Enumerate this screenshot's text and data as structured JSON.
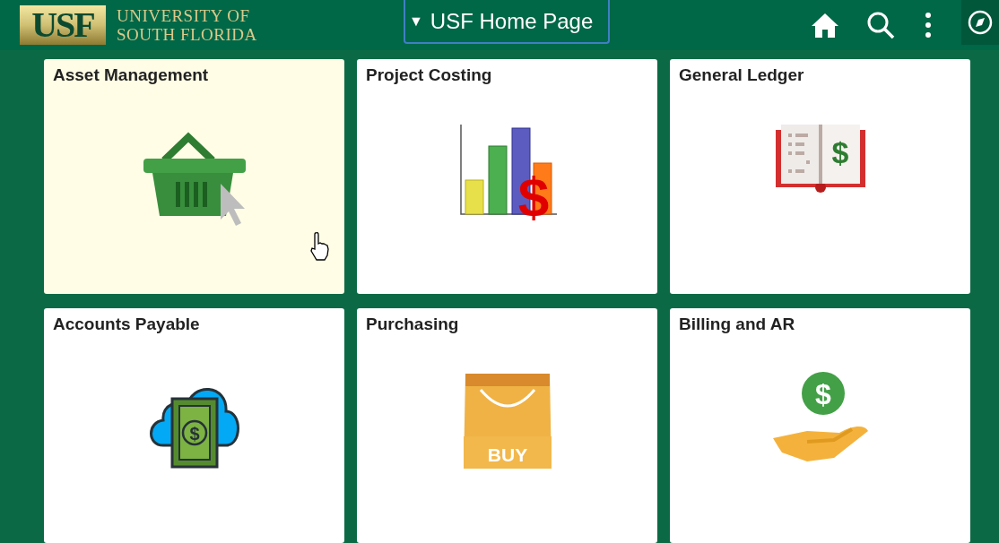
{
  "header": {
    "logo_mark": "USF",
    "logo_text": [
      "UNIVERSITY OF",
      "SOUTH FLORIDA"
    ],
    "page_menu": {
      "caret": "▼",
      "label": "USF Home Page"
    }
  },
  "tiles": [
    {
      "title": "Asset Management",
      "kind": "basket",
      "hovered": true
    },
    {
      "title": "Project Costing",
      "kind": "chart",
      "hovered": false,
      "icon_text": "$"
    },
    {
      "title": "General Ledger",
      "kind": "ledger",
      "hovered": false,
      "icon_text": "$"
    },
    {
      "title": "Accounts Payable",
      "kind": "cloud",
      "hovered": false,
      "icon_text": "$"
    },
    {
      "title": "Purchasing",
      "kind": "bag",
      "hovered": false,
      "icon_text": "BUY"
    },
    {
      "title": "Billing and AR",
      "kind": "hand",
      "hovered": false,
      "icon_text": "$"
    }
  ]
}
